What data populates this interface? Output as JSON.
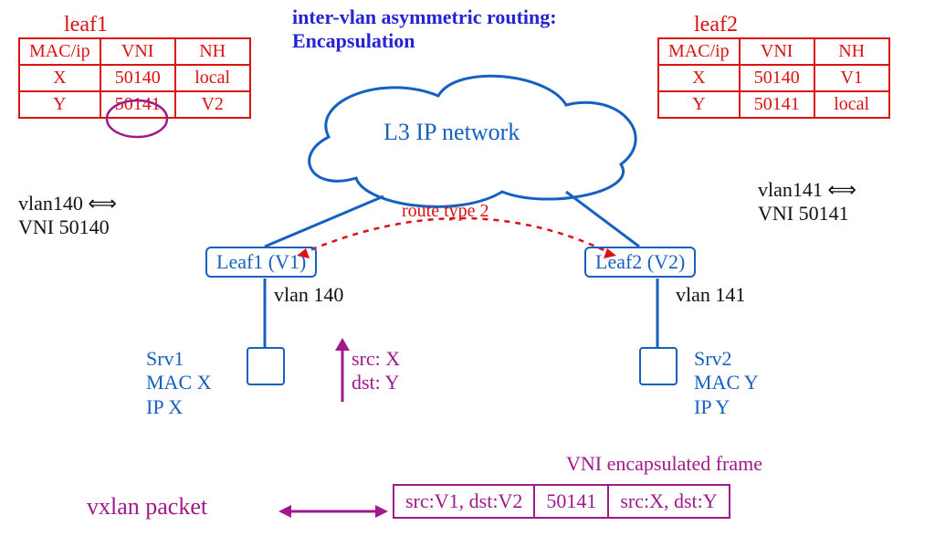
{
  "title_line1": "inter-vlan asymmetric routing:",
  "title_line2": "Encapsulation",
  "leaf1": {
    "caption": "leaf1",
    "headers": [
      "MAC/ip",
      "VNI",
      "NH"
    ],
    "rows": [
      [
        "X",
        "50140",
        "local"
      ],
      [
        "Y",
        "50141",
        "V2"
      ]
    ]
  },
  "leaf2": {
    "caption": "leaf2",
    "headers": [
      "MAC/ip",
      "VNI",
      "NH"
    ],
    "rows": [
      [
        "X",
        "50140",
        "V1"
      ],
      [
        "Y",
        "50141",
        "local"
      ]
    ]
  },
  "cloud_label": "L3 IP network",
  "route_label": "route type 2",
  "leaf1_box": "Leaf1 (V1)",
  "leaf2_box": "Leaf2 (V2)",
  "leaf1_vlan": "vlan 140",
  "leaf2_vlan": "vlan 141",
  "note_left_1": "vlan140 ⟺",
  "note_left_2": "VNI 50140",
  "note_right_1": "vlan141 ⟺",
  "note_right_2": "VNI 50141",
  "srv1_line1": "Srv1",
  "srv1_line2": "MAC X",
  "srv1_line3": "IP X",
  "srv2_line1": "Srv2",
  "srv2_line2": "MAC Y",
  "srv2_line3": "IP Y",
  "arrow_src": "src: X",
  "arrow_dst": "dst: Y",
  "vxlan_label": "vxlan packet",
  "vni_encap_label": "VNI encapsulated frame",
  "packet": {
    "outer": "src:V1, dst:V2",
    "vni": "50141",
    "inner": "src:X, dst:Y"
  },
  "chart_data": {
    "type": "diagram",
    "title": "inter-vlan asymmetric routing: Encapsulation",
    "nodes": [
      {
        "id": "cloud",
        "label": "L3 IP network"
      },
      {
        "id": "leaf1",
        "label": "Leaf1 (V1)",
        "vlan": 140,
        "vni": 50140
      },
      {
        "id": "leaf2",
        "label": "Leaf2 (V2)",
        "vlan": 141,
        "vni": 50141
      },
      {
        "id": "srv1",
        "label": "Srv1",
        "mac": "MAC X",
        "ip": "IP X"
      },
      {
        "id": "srv2",
        "label": "Srv2",
        "mac": "MAC Y",
        "ip": "IP Y"
      }
    ],
    "edges": [
      {
        "from": "cloud",
        "to": "leaf1"
      },
      {
        "from": "cloud",
        "to": "leaf2"
      },
      {
        "from": "leaf1",
        "to": "srv1"
      },
      {
        "from": "leaf2",
        "to": "srv2"
      },
      {
        "from": "leaf1",
        "to": "leaf2",
        "label": "route type 2",
        "style": "dashed"
      }
    ],
    "tables": {
      "leaf1": [
        {
          "mac_ip": "X",
          "vni": 50140,
          "nh": "local"
        },
        {
          "mac_ip": "Y",
          "vni": 50141,
          "nh": "V2"
        }
      ],
      "leaf2": [
        {
          "mac_ip": "X",
          "vni": 50140,
          "nh": "V1"
        },
        {
          "mac_ip": "Y",
          "vni": 50141,
          "nh": "local"
        }
      ]
    },
    "traffic": {
      "src": "X",
      "dst": "Y"
    },
    "vxlan_packet": {
      "outer": {
        "src": "V1",
        "dst": "V2"
      },
      "vni": 50141,
      "inner": {
        "src": "X",
        "dst": "Y"
      }
    }
  }
}
